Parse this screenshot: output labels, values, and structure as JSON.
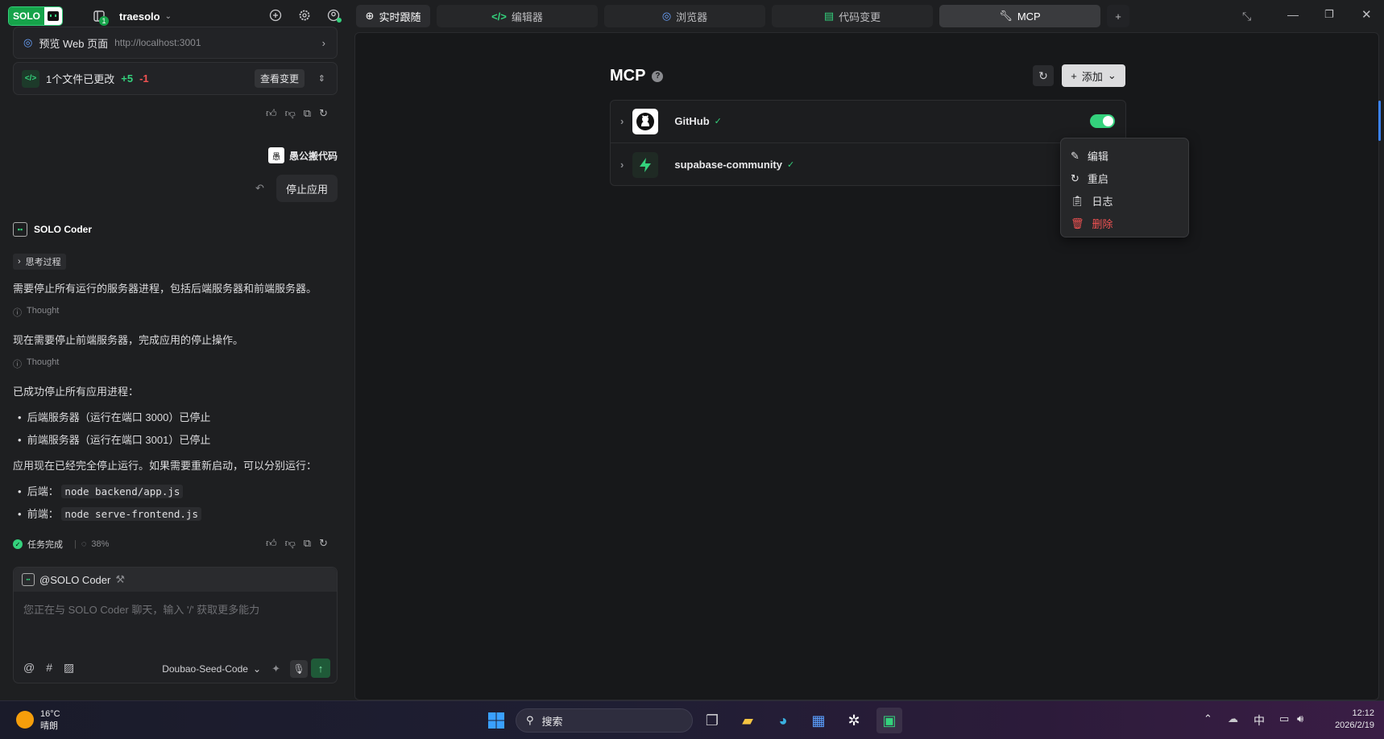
{
  "topbar": {
    "logo_text": "SOLO",
    "project_name": "traesolo",
    "badge_count": "1"
  },
  "tabs": [
    {
      "label": "实时跟随",
      "icon": "target-icon"
    },
    {
      "label": "编辑器",
      "icon": "code-icon"
    },
    {
      "label": "浏览器",
      "icon": "compass-icon"
    },
    {
      "label": "代码变更",
      "icon": "diff-icon"
    },
    {
      "label": "MCP",
      "icon": "wrench-icon"
    }
  ],
  "preview": {
    "label": "预览 Web 页面",
    "url": "http://localhost:3001"
  },
  "changes": {
    "label": "1个文件已更改",
    "added": "+5",
    "removed": "-1",
    "button": "查看变更"
  },
  "user": {
    "name": "愚公搬代码",
    "message": "停止应用"
  },
  "agent": {
    "name": "SOLO Coder",
    "thinking_label": "思考过程",
    "line1": "需要停止所有运行的服务器进程，包括后端服务器和前端服务器。",
    "thought_label": "Thought",
    "line2": "现在需要停止前端服务器，完成应用的停止操作。",
    "line3": "已成功停止所有应用进程：",
    "bullets": [
      "后端服务器（运行在端口 3000）已停止",
      "前端服务器（运行在端口 3001）已停止"
    ],
    "line4": "应用现在已经完全停止运行。如果需要重新启动，可以分别运行：",
    "cmd_backend_label": "后端：",
    "cmd_backend": "node backend/app.js",
    "cmd_frontend_label": "前端：",
    "cmd_frontend": "node serve-frontend.js",
    "status": "任务完成",
    "progress": "38%"
  },
  "input": {
    "mention": "@SOLO Coder",
    "placeholder": "您正在与 SOLO Coder 聊天，输入 '/' 获取更多能力",
    "model": "Doubao-Seed-Code"
  },
  "mcp": {
    "title": "MCP",
    "add_label": "添加",
    "servers": [
      {
        "name": "GitHub",
        "enabled": true
      },
      {
        "name": "supabase-community"
      }
    ],
    "menu": [
      "编辑",
      "重启",
      "日志",
      "删除"
    ]
  },
  "taskbar": {
    "temp": "16°C",
    "weather": "晴朗",
    "search": "搜索",
    "ime": "中",
    "time": "12:12",
    "date": "2026/2/19"
  },
  "colors": {
    "accent": "#34d17c",
    "danger": "#f05252",
    "added": "#34d17c"
  }
}
